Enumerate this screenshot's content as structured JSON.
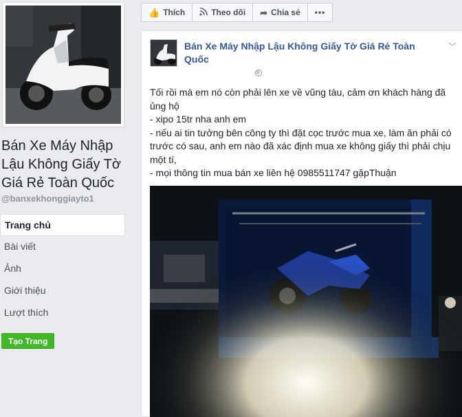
{
  "page": {
    "name": "Bán Xe Máy Nhập Lậu Không Giấy Tờ Giá Rẻ Toàn Quốc",
    "handle": "@banxekhonggiayto1"
  },
  "nav": {
    "items": [
      {
        "label": "Trang chủ",
        "active": true
      },
      {
        "label": "Bài viết"
      },
      {
        "label": "Ảnh"
      },
      {
        "label": "Giới thiệu"
      },
      {
        "label": "Lượt thích"
      }
    ],
    "create_label": "Tạo Trang"
  },
  "actions": {
    "like_label": "Thích",
    "follow_label": "Theo dõi",
    "share_label": "Chia sẻ",
    "more_label": "•••"
  },
  "post": {
    "author": "Bán Xe Máy Nhập Lậu Không Giấy Tờ Giá Rẻ Toàn Quốc",
    "lines": [
      "Tối rồi mà em nó còn phải lên xe về vũng tàu, cảm ơn khách hàng đã ủng hộ",
      "- xipo 15tr nha anh em",
      "- nếu ai tin tưởng bên công ty thì đặt cọc trước mua xe, làm ăn phải có trước có sau, anh em nào đã xác định mua xe không giấy thì phải chịu một tí,",
      "- mọi thông tin mua bán xe liên hệ 0985511747 gặpThuận"
    ]
  },
  "colors": {
    "link": "#365899",
    "create_button": "#42b72a",
    "background": "#e9ebee"
  }
}
